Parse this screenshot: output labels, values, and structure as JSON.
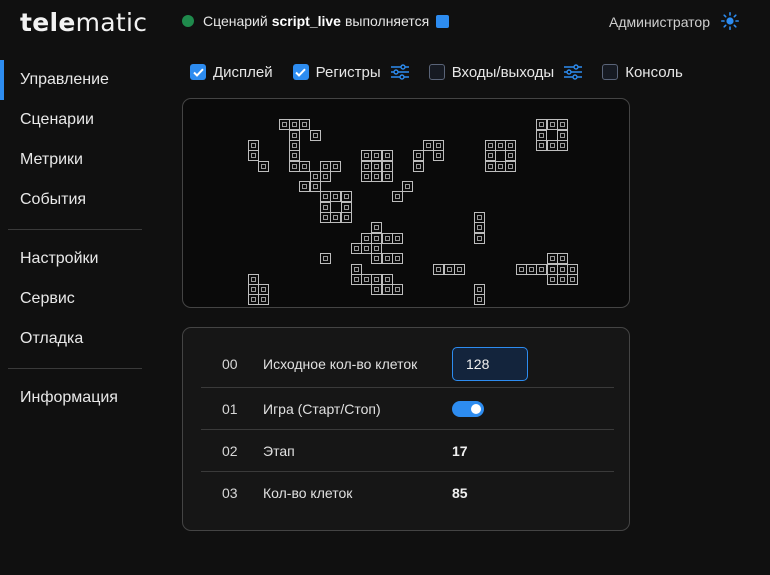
{
  "header": {
    "logo_left": "tele",
    "logo_right": "matic",
    "status_prefix": "Сценарий",
    "status_script": "script_live",
    "status_suffix": "выполняется",
    "user": "Администратор",
    "colors": {
      "status_dot": "#1f8a4c",
      "accent": "#2d8cf0"
    },
    "theme_icon": "sun-icon"
  },
  "sidebar": {
    "groups": [
      [
        {
          "label": "Управление",
          "active": true
        },
        {
          "label": "Сценарии"
        },
        {
          "label": "Метрики"
        },
        {
          "label": "События"
        }
      ],
      [
        {
          "label": "Настройки"
        },
        {
          "label": "Сервис"
        },
        {
          "label": "Отладка"
        }
      ],
      [
        {
          "label": "Информация"
        }
      ]
    ]
  },
  "toolbar": {
    "items": [
      {
        "label": "Дисплей",
        "checked": true,
        "tune": false
      },
      {
        "label": "Регистры",
        "checked": true,
        "tune": true
      },
      {
        "label": "Входы/выходы",
        "checked": false,
        "tune": true
      },
      {
        "label": "Консоль",
        "checked": false,
        "tune": false
      }
    ]
  },
  "display": {
    "live_cells": [
      [
        6,
        3
      ],
      [
        9,
        1
      ],
      [
        10,
        1
      ],
      [
        11,
        1
      ],
      [
        10,
        2
      ],
      [
        12,
        2
      ],
      [
        6,
        4
      ],
      [
        10,
        3
      ],
      [
        10,
        4
      ],
      [
        10,
        5
      ],
      [
        11,
        5
      ],
      [
        7,
        5
      ],
      [
        13,
        5
      ],
      [
        14,
        5
      ],
      [
        12,
        6
      ],
      [
        13,
        6
      ],
      [
        11,
        7
      ],
      [
        12,
        7
      ],
      [
        17,
        4
      ],
      [
        18,
        4
      ],
      [
        19,
        4
      ],
      [
        17,
        5
      ],
      [
        18,
        5
      ],
      [
        19,
        5
      ],
      [
        17,
        6
      ],
      [
        18,
        6
      ],
      [
        19,
        6
      ],
      [
        23,
        3
      ],
      [
        24,
        3
      ],
      [
        22,
        4
      ],
      [
        24,
        4
      ],
      [
        22,
        5
      ],
      [
        21,
        7
      ],
      [
        20,
        8
      ],
      [
        29,
        3
      ],
      [
        30,
        3
      ],
      [
        31,
        3
      ],
      [
        29,
        4
      ],
      [
        31,
        4
      ],
      [
        29,
        5
      ],
      [
        30,
        5
      ],
      [
        31,
        5
      ],
      [
        34,
        1
      ],
      [
        35,
        1
      ],
      [
        36,
        1
      ],
      [
        34,
        2
      ],
      [
        36,
        2
      ],
      [
        34,
        3
      ],
      [
        35,
        3
      ],
      [
        36,
        3
      ],
      [
        13,
        8
      ],
      [
        14,
        8
      ],
      [
        15,
        8
      ],
      [
        13,
        9
      ],
      [
        15,
        9
      ],
      [
        13,
        10
      ],
      [
        14,
        10
      ],
      [
        15,
        10
      ],
      [
        28,
        10
      ],
      [
        28,
        11
      ],
      [
        28,
        12
      ],
      [
        18,
        11
      ],
      [
        18,
        12
      ],
      [
        19,
        12
      ],
      [
        20,
        12
      ],
      [
        17,
        12
      ],
      [
        16,
        13
      ],
      [
        17,
        13
      ],
      [
        18,
        13
      ],
      [
        13,
        14
      ],
      [
        18,
        14
      ],
      [
        19,
        14
      ],
      [
        20,
        14
      ],
      [
        16,
        15
      ],
      [
        16,
        16
      ],
      [
        17,
        16
      ],
      [
        18,
        16
      ],
      [
        19,
        16
      ],
      [
        18,
        17
      ],
      [
        19,
        17
      ],
      [
        20,
        17
      ],
      [
        18,
        16
      ],
      [
        24,
        15
      ],
      [
        25,
        15
      ],
      [
        26,
        15
      ],
      [
        32,
        15
      ],
      [
        33,
        15
      ],
      [
        34,
        15
      ],
      [
        35,
        14
      ],
      [
        36,
        14
      ],
      [
        35,
        15
      ],
      [
        36,
        15
      ],
      [
        37,
        15
      ],
      [
        35,
        16
      ],
      [
        37,
        16
      ],
      [
        36,
        16
      ],
      [
        6,
        16
      ],
      [
        6,
        17
      ],
      [
        7,
        17
      ],
      [
        6,
        18
      ],
      [
        7,
        18
      ],
      [
        28,
        17
      ],
      [
        28,
        18
      ]
    ]
  },
  "registers": [
    {
      "index": "00",
      "name": "Исходное кол-во клеток",
      "type": "input",
      "value": "128"
    },
    {
      "index": "01",
      "name": "Игра (Старт/Стоп)",
      "type": "toggle",
      "value": true
    },
    {
      "index": "02",
      "name": "Этап",
      "type": "value",
      "value": "17"
    },
    {
      "index": "03",
      "name": "Кол-во клеток",
      "type": "value",
      "value": "85"
    }
  ]
}
